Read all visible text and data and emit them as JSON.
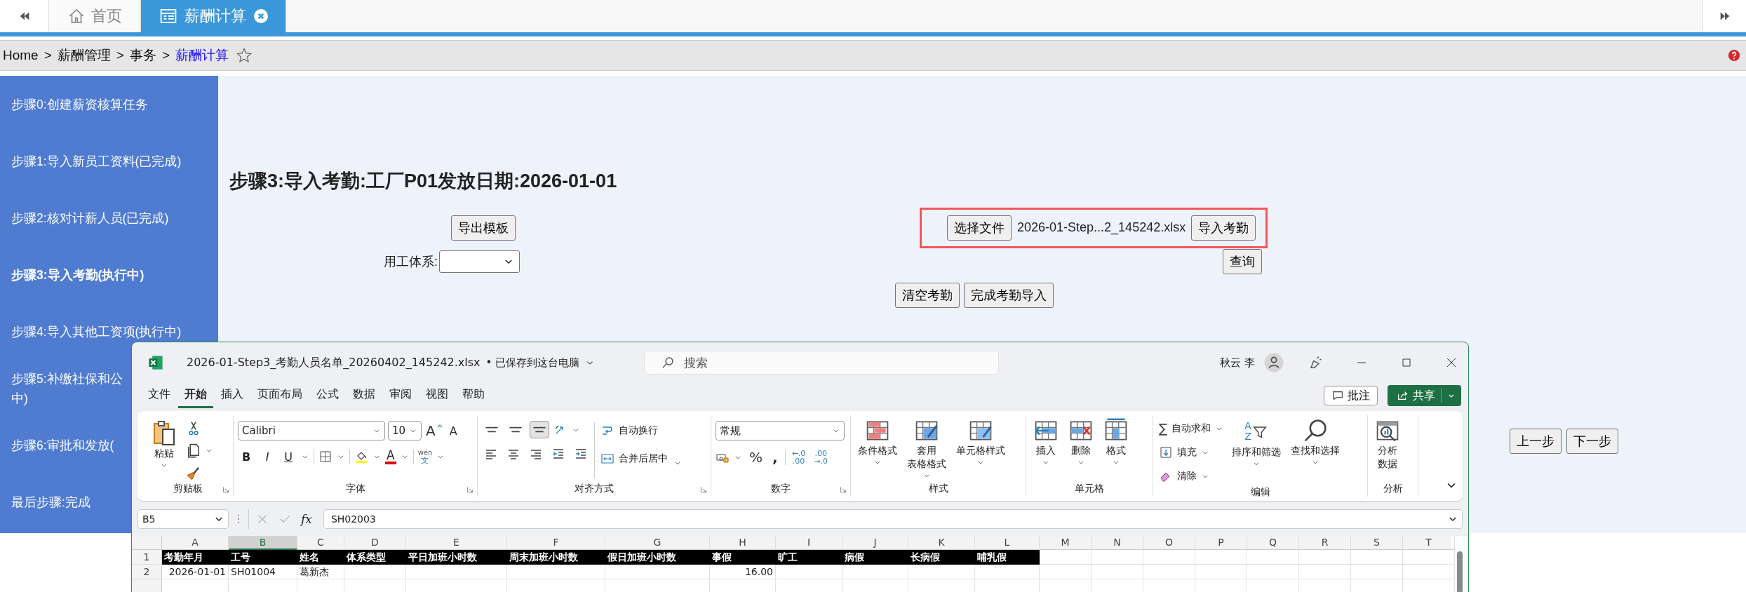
{
  "top_bar": {
    "tabs": [
      {
        "label": "首页",
        "selected": false,
        "closable": false
      },
      {
        "label": "薪酬计算",
        "selected": true,
        "closable": true
      }
    ]
  },
  "breadcrumb": {
    "separator": ">",
    "items": [
      {
        "label": "Home",
        "current": false
      },
      {
        "label": "薪酬管理",
        "current": false
      },
      {
        "label": "事务",
        "current": false
      },
      {
        "label": "薪酬计算",
        "current": true
      }
    ]
  },
  "sidebar": {
    "items": [
      {
        "label": "步骤0:创建薪资核算任务",
        "selected": false
      },
      {
        "label": "步骤1:导入新员工资料(已完成)",
        "selected": false
      },
      {
        "label": "步骤2:核对计薪人员(已完成)",
        "selected": false
      },
      {
        "label": "步骤3:导入考勤(执行中)",
        "selected": true
      },
      {
        "label": "步骤4:导入其他工资项(执行中)",
        "selected": false
      },
      {
        "label": "步骤5:补缴社保和公",
        "continuation": "中)",
        "selected": false
      },
      {
        "label": "步骤6:审批和发放(",
        "selected": false
      },
      {
        "label": "最后步骤:完成",
        "selected": false
      }
    ]
  },
  "main": {
    "heading": "步骤3:导入考勤:工厂P01发放日期:2026-01-01",
    "export_button": "导出模板",
    "system_label": "用工体系:",
    "file_import": {
      "highlighted": true,
      "choose_button": "选择文件",
      "file_name": "2026-01-Step...2_145242.xlsx",
      "import_button": "导入考勤"
    },
    "query_button": "查询",
    "clear_button": "清空考勤",
    "finish_button": "完成考勤导入",
    "nav_buttons": [
      "上一步",
      "下一步"
    ]
  },
  "excel": {
    "title": "2026-01-Step3_考勤人员名单_20260402_145242.xlsx",
    "save_status": "• 已保存到这台电脑",
    "search": {
      "placeholder": "搜索"
    },
    "user": "秋云 李",
    "menu": [
      {
        "label": "文件",
        "selected": false
      },
      {
        "label": "开始",
        "selected": true
      },
      {
        "label": "插入",
        "selected": false
      },
      {
        "label": "页面布局",
        "selected": false
      },
      {
        "label": "公式",
        "selected": false
      },
      {
        "label": "数据",
        "selected": false
      },
      {
        "label": "审阅",
        "selected": false
      },
      {
        "label": "视图",
        "selected": false
      },
      {
        "label": "帮助",
        "selected": false
      }
    ],
    "comment_button": "批注",
    "share_button": "共享",
    "ribbon": {
      "groups": [
        {
          "kind": "clipboard",
          "label": "剪贴板",
          "launcher": true,
          "paste": "粘贴"
        },
        {
          "kind": "font",
          "label": "字体",
          "launcher": true,
          "font_name": "Calibri",
          "font_size": "10",
          "grow": "A",
          "shrink": "A",
          "styles": [
            "B",
            "I",
            "U"
          ],
          "font_color": "A",
          "phonetic": [
            "wén",
            "文"
          ]
        },
        {
          "kind": "alignment",
          "label": "对齐方式",
          "launcher": true,
          "vertical_buttons": [
            {
              "selected": false
            },
            {
              "selected": false
            },
            {
              "selected": true
            }
          ],
          "wrap_text": "自动换行",
          "merge_center": "合并后居中"
        },
        {
          "kind": "number",
          "label": "数字",
          "launcher": true,
          "format": "常规",
          "percent": "%",
          "comma": ",",
          "decimals": [
            [
              "←.0",
              ".00"
            ],
            [
              ".00",
              "→.0"
            ]
          ]
        },
        {
          "kind": "styles",
          "label": "样式",
          "buttons": [
            [
              "条件格式"
            ],
            [
              "套用",
              "表格格式"
            ],
            [
              "单元格样式"
            ]
          ]
        },
        {
          "kind": "cells",
          "label": "单元格",
          "buttons": [
            "插入",
            "删除",
            "格式"
          ]
        },
        {
          "kind": "editing",
          "label": "编辑",
          "autosum_symbol": "∑",
          "autosum": "自动求和",
          "fill": "填充",
          "clear": "清除",
          "sort_letters": [
            "A",
            "Z"
          ],
          "sort": "排序和筛选",
          "find": "查找和选择"
        },
        {
          "kind": "analysis",
          "label": "分析",
          "button": [
            "分析",
            "数据"
          ]
        }
      ]
    },
    "name_box": "B5",
    "formula_symbol": "fx",
    "formula": "SH02003",
    "columns": [
      {
        "label": "A",
        "selected": false
      },
      {
        "label": "B",
        "selected": true
      },
      {
        "label": "C",
        "selected": false
      },
      {
        "label": "D",
        "selected": false
      },
      {
        "label": "E",
        "selected": false
      },
      {
        "label": "F",
        "selected": false
      },
      {
        "label": "G",
        "selected": false
      },
      {
        "label": "H",
        "selected": false
      },
      {
        "label": "I",
        "selected": false
      },
      {
        "label": "J",
        "selected": false
      },
      {
        "label": "K",
        "selected": false
      },
      {
        "label": "L",
        "selected": false
      },
      {
        "label": "M",
        "selected": false
      },
      {
        "label": "N",
        "selected": false
      },
      {
        "label": "O",
        "selected": false
      },
      {
        "label": "P",
        "selected": false
      },
      {
        "label": "Q",
        "selected": false
      },
      {
        "label": "R",
        "selected": false
      },
      {
        "label": "S",
        "selected": false
      },
      {
        "label": "T",
        "selected": false
      }
    ],
    "rows": [
      {
        "number": "1",
        "cells": {
          "A": {
            "text": "考勤年月",
            "kind": "header"
          },
          "B": {
            "text": "工号",
            "kind": "header"
          },
          "C": {
            "text": "姓名",
            "kind": "header"
          },
          "D": {
            "text": "体系类型",
            "kind": "header"
          },
          "E": {
            "text": "平日加班小时数",
            "kind": "header"
          },
          "F": {
            "text": "周末加班小时数",
            "kind": "header"
          },
          "G": {
            "text": "假日加班小时数",
            "kind": "header"
          },
          "H": {
            "text": "事假",
            "kind": "header"
          },
          "I": {
            "text": "旷工",
            "kind": "header"
          },
          "J": {
            "text": "病假",
            "kind": "header"
          },
          "K": {
            "text": "长病假",
            "kind": "header"
          },
          "L": {
            "text": "哺乳假",
            "kind": "header"
          }
        }
      },
      {
        "number": "2",
        "cells": {
          "A": {
            "text": "2026-01-01",
            "kind": "date"
          },
          "B": {
            "text": "SH01004",
            "kind": "text"
          },
          "C": {
            "text": "葛新杰",
            "kind": "text"
          },
          "H": {
            "text": "16.00",
            "kind": "number"
          }
        }
      }
    ]
  }
}
